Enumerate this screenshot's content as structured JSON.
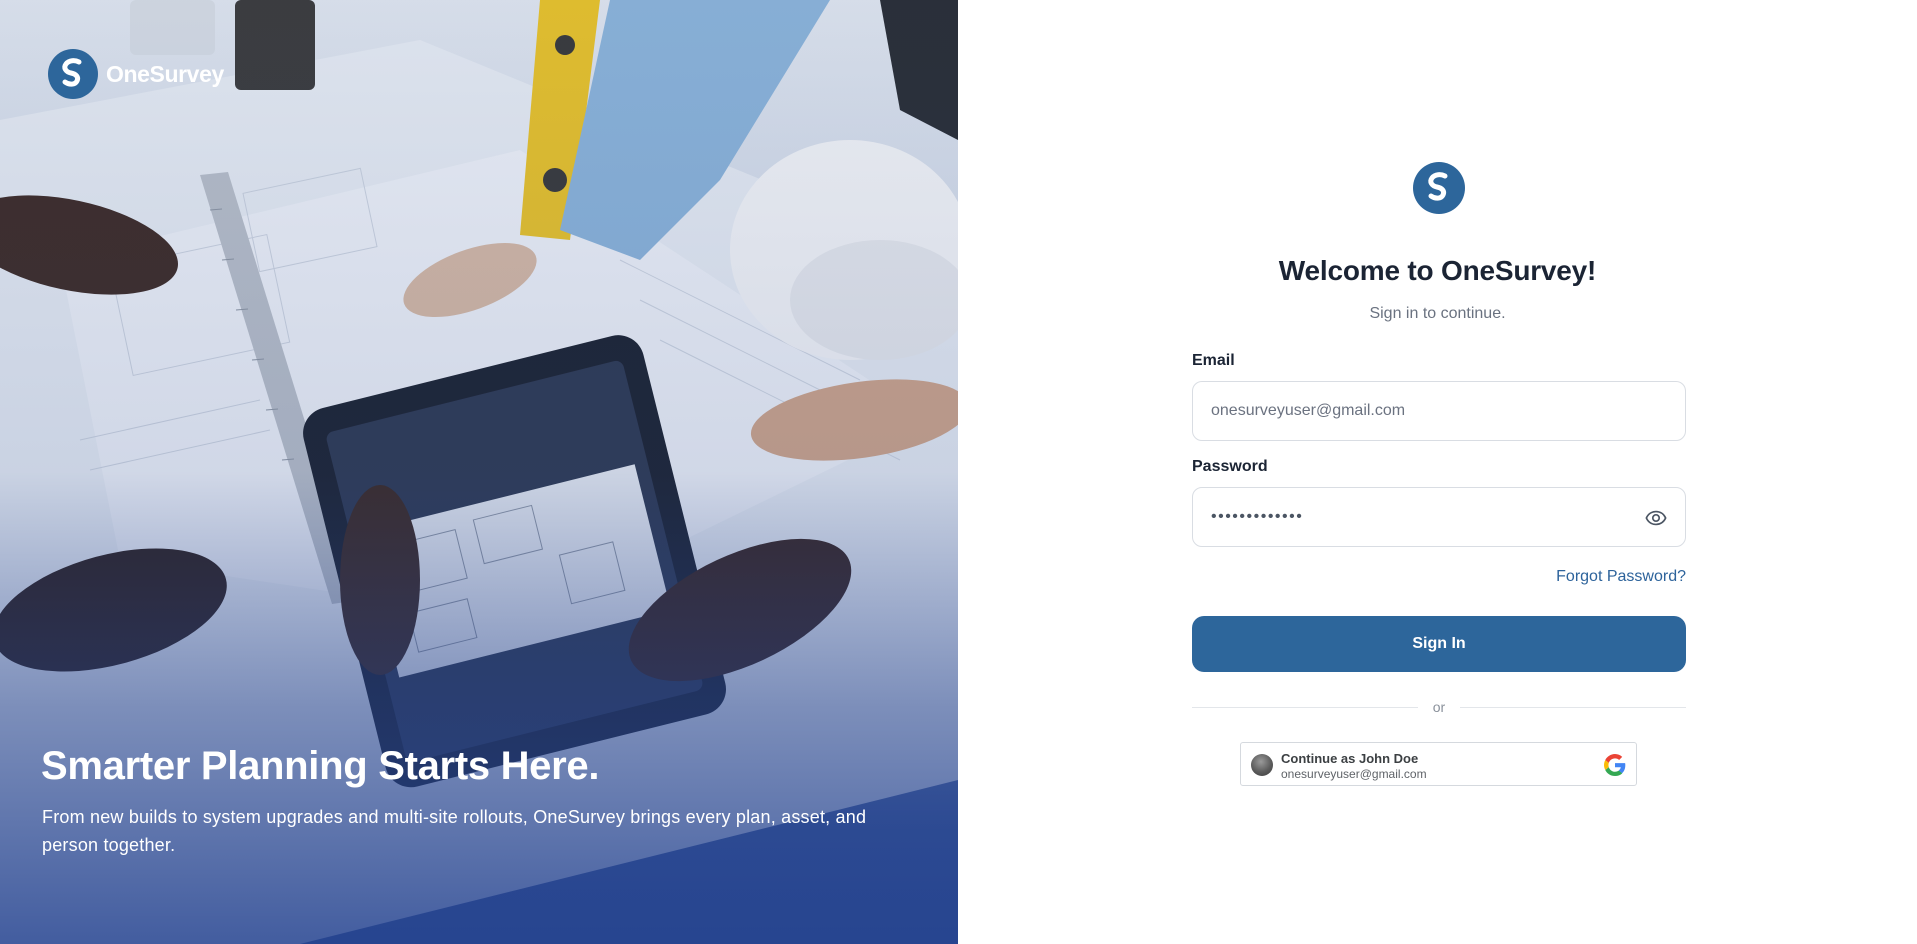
{
  "brand": {
    "name": "OneSurvey",
    "logo_icon": "onesurvey-logo-icon"
  },
  "hero": {
    "title": "Smarter Planning Starts Here.",
    "subtitle": "From new builds to system upgrades and multi-site rollouts, OneSurvey brings every plan, asset, and person together."
  },
  "signin": {
    "welcome": "Welcome to OneSurvey!",
    "subtitle": "Sign in to continue.",
    "email_label": "Email",
    "email_value": "onesurveyuser@gmail.com",
    "password_label": "Password",
    "password_masked": "•••••••••••••",
    "show_password_icon": "eye-icon",
    "forgot_password": "Forgot Password?",
    "signin_button": "Sign In",
    "divider_text": "or"
  },
  "google": {
    "name": "Continue as John Doe",
    "email": "onesurveyuser@gmail.com",
    "icon": "google-icon"
  },
  "colors": {
    "primary": "#2d669b",
    "link": "#2d639b",
    "heading": "#1b2434",
    "muted": "#6a7280",
    "hero_overlay": "#2c4a8c"
  }
}
